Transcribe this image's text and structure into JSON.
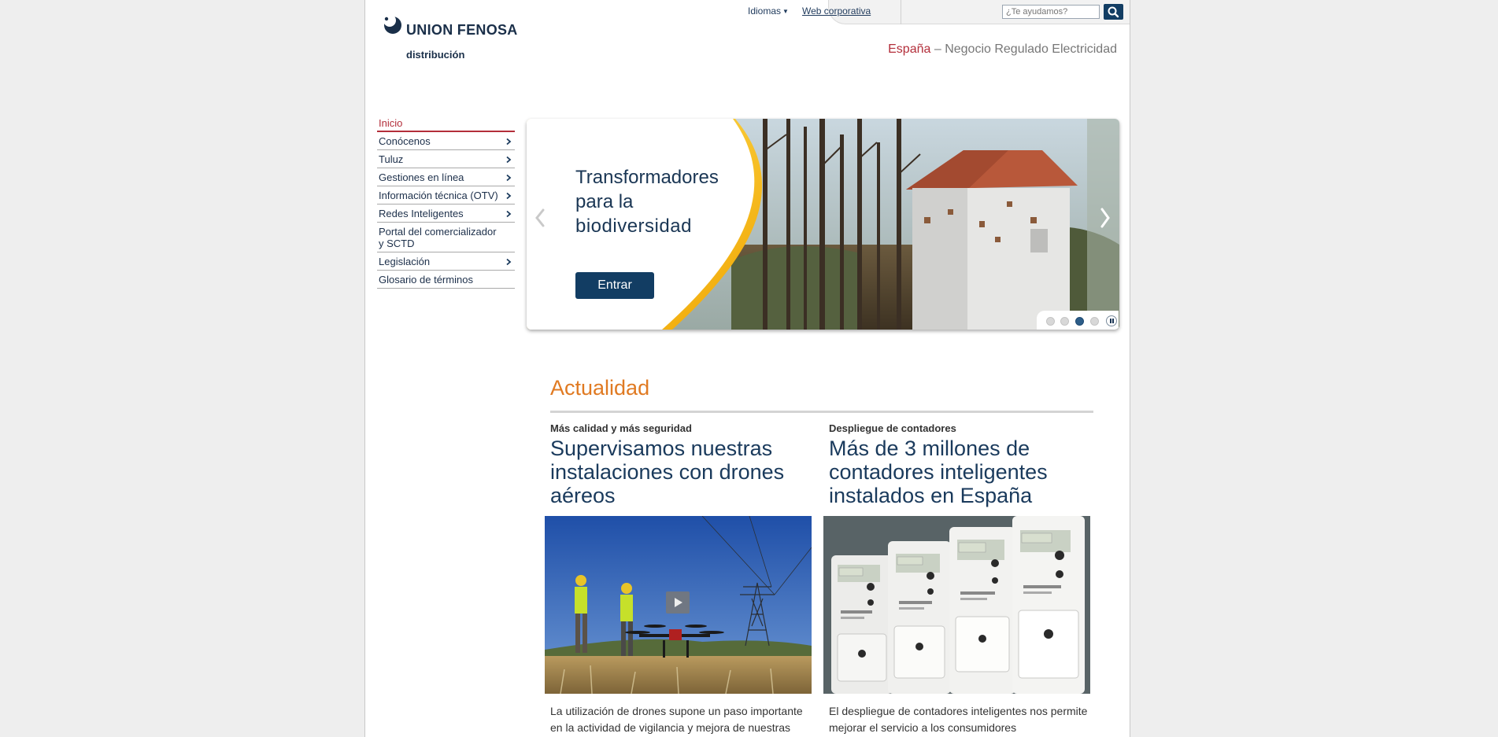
{
  "brand": {
    "name": "UNION FENOSA",
    "sub": "distribución",
    "colors": {
      "navy": "#123d63",
      "red": "#b32e3a",
      "orange": "#e07a22",
      "yellow": "#f5b800"
    }
  },
  "header": {
    "languages_label": "Idiomas",
    "corporate_link": "Web corporativa",
    "search_placeholder": "¿Te ayudamos?",
    "search_icon": "search-icon",
    "country": "España",
    "separator": "–",
    "business": "Negocio Regulado Electricidad"
  },
  "nav": {
    "active": "Inicio",
    "items": [
      {
        "label": "Conócenos",
        "has_submenu": true
      },
      {
        "label": "Tuluz",
        "has_submenu": true
      },
      {
        "label": "Gestiones en línea",
        "has_submenu": true
      },
      {
        "label": "Información técnica (OTV)",
        "has_submenu": true
      },
      {
        "label": "Redes Inteligentes",
        "has_submenu": true
      },
      {
        "label": "Portal del comercializador y SCTD",
        "has_submenu": false
      },
      {
        "label": "Legislación",
        "has_submenu": true
      },
      {
        "label": "Glosario de términos",
        "has_submenu": false
      }
    ]
  },
  "hero": {
    "title_line1": "Transformadores",
    "title_line2": "para la",
    "title_line3": "biodiversidad",
    "button": "Entrar",
    "slide_count": 4,
    "active_slide": 3
  },
  "news": {
    "section_title": "Actualidad",
    "articles": [
      {
        "kicker": "Más calidad y más seguridad",
        "title": "Supervisamos nuestras instalaciones con drones aéreos",
        "text": "La utilización de drones supone un paso importante en la actividad de vigilancia y mejora de nuestras"
      },
      {
        "kicker": "Despliegue de contadores",
        "title": "Más de 3 millones de contadores inteligentes instalados en España",
        "text": "El despliegue de contadores inteligentes nos permite mejorar el servicio a los consumidores"
      }
    ]
  }
}
